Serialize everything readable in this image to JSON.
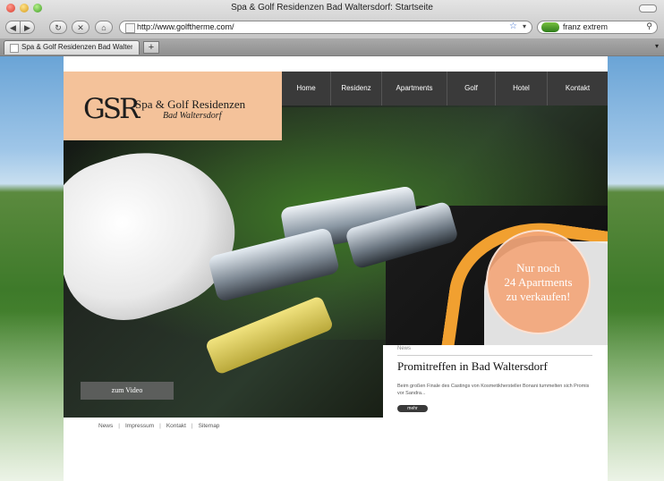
{
  "browser": {
    "window_title": "Spa & Golf Residenzen Bad Waltersdorf: Startseite",
    "url": "http://www.golftherme.com/",
    "search_query": "franz extrem",
    "tabs": [
      {
        "label": "Spa & Golf Residenzen Bad Walter..."
      }
    ],
    "new_tab_label": "+",
    "icons": [
      "back-icon",
      "forward-icon",
      "reload-icon",
      "stop-icon",
      "home-icon",
      "star-icon",
      "search-icon"
    ]
  },
  "site": {
    "logo": {
      "monogram": "GSR",
      "name": "Spa & Golf Residenzen",
      "location": "Bad Waltersdorf",
      "color": "#f4c29a"
    },
    "nav": [
      {
        "label": "Home"
      },
      {
        "label": "Residenz"
      },
      {
        "label": "Apartments"
      },
      {
        "label": "Golf"
      },
      {
        "label": "Hotel"
      },
      {
        "label": "Kontakt"
      }
    ],
    "promo_bubble": {
      "line1": "Nur noch",
      "line2": "24 Apartments",
      "line3": "zu verkaufen!"
    },
    "news": {
      "label": "News",
      "title": "Promitreffen in Bad Waltersdorf",
      "text": "Beim großen Finale des Castings von Kosmetikhersteller Bonani tummelten sich Promis vor Sandra...",
      "more": "mehr"
    },
    "video_button": "zum Video",
    "footer": [
      {
        "label": "News"
      },
      {
        "label": "Impressum"
      },
      {
        "label": "Kontakt"
      },
      {
        "label": "Sitemap"
      }
    ],
    "footer_separator": "|",
    "colors": {
      "accent": "#f4c29a",
      "nav_bg": "#3a3a3a",
      "bubble": "#f3a67a"
    }
  }
}
